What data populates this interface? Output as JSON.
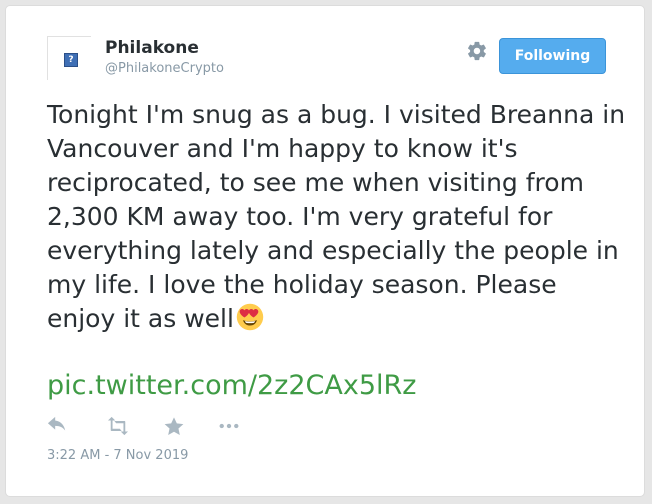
{
  "user": {
    "display_name": "Philakone",
    "handle": "@PhilakoneCrypto",
    "avatar_placeholder": "?"
  },
  "follow_button": {
    "label": "Following"
  },
  "tweet": {
    "text": "Tonight I'm snug as a bug. I visited Breanna in Vancouver and I'm happy to know it's reciprocated, to see me when visiting from 2,300 KM away too. I'm very grateful for everything lately and especially the people in my life. I love the holiday season. Please enjoy it as well",
    "link": "pic.twitter.com/2z2CAx5lRz",
    "timestamp": "3:22 AM - 7 Nov 2019"
  },
  "icons": {
    "settings": "gear-icon",
    "reply": "reply-icon",
    "retweet": "retweet-icon",
    "favorite": "star-icon",
    "more": "more-icon",
    "emoji": "heart-eyes-emoji-icon"
  },
  "colors": {
    "follow_button": "#55acee",
    "link": "#3f9b45",
    "muted": "#8899a6",
    "text": "#292f33"
  }
}
